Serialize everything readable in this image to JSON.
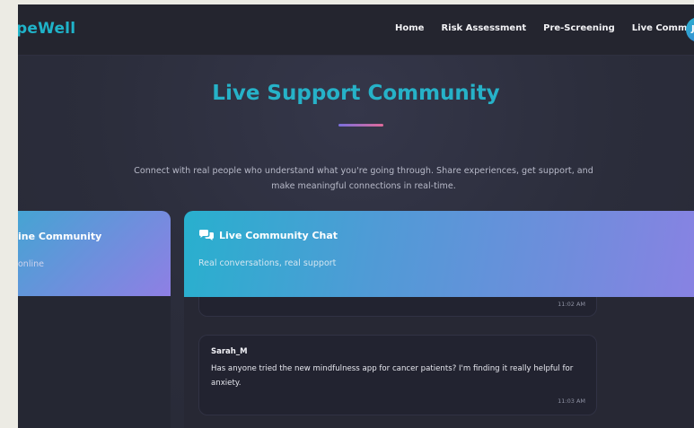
{
  "navbar": {
    "brand": "peWell",
    "links": [
      "Home",
      "Risk Assessment",
      "Pre-Screening",
      "Live Community"
    ],
    "avatar_initials": "Jo"
  },
  "hero": {
    "title": "Live Support Community",
    "subtitle": "Connect with real people who understand what you're going through. Share experiences, get support, and make meaningful connections in real-time."
  },
  "left_panel": {
    "title": "ine Community",
    "subtitle": "online"
  },
  "chat": {
    "icon": "comments-icon",
    "title": "Live Community Chat",
    "subtitle": "Real conversations, real support",
    "messages": [
      {
        "time": "11:02 AM"
      },
      {
        "author": "Sarah_M",
        "text": "Has anyone tried the new mindfulness app for cancer patients? I'm finding it really helpful for anxiety.",
        "time": "11:03 AM"
      }
    ]
  },
  "colors": {
    "brand": "#1fb3c9",
    "title": "#26b2c8",
    "header_gradient_start": "#28b0ce",
    "header_gradient_end": "#8d80e4",
    "background": "#2b2d3b"
  }
}
